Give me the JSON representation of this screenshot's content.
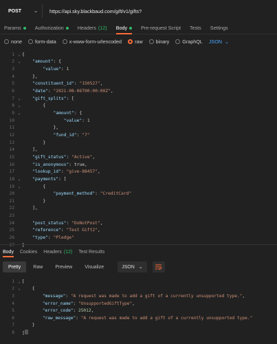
{
  "request": {
    "method": "POST",
    "url": "https://api.sky.blackbaud.com/gift/v1/gifts?"
  },
  "request_tabs": [
    {
      "label": "Params",
      "dot": true,
      "count": "",
      "active": false
    },
    {
      "label": "Authorization",
      "dot": true,
      "count": "",
      "active": false
    },
    {
      "label": "Headers",
      "dot": false,
      "count": "(12)",
      "active": false
    },
    {
      "label": "Body",
      "dot": true,
      "count": "",
      "active": true
    },
    {
      "label": "Pre-request Script",
      "dot": false,
      "count": "",
      "active": false
    },
    {
      "label": "Tests",
      "dot": false,
      "count": "",
      "active": false
    },
    {
      "label": "Settings",
      "dot": false,
      "count": "",
      "active": false
    }
  ],
  "body_types": [
    "none",
    "form-data",
    "x-www-form-urlencoded",
    "raw",
    "binary",
    "GraphQL"
  ],
  "body_type_selected": "raw",
  "body_format": "JSON",
  "request_body_lines": [
    "{",
    "    \"amount\": {",
    "        \"value\": 1",
    "    },",
    "    \"constituent_id\": \"150527\",",
    "    \"date\": \"2021-08-06T00:00:00Z\",",
    "    \"gift_splits\": [",
    "        {",
    "            \"amount\": {",
    "                \"value\": 1",
    "            },",
    "            \"fund_id\": \"7\"",
    "        }",
    "    ],",
    "    \"gift_status\": \"Active\",",
    "    \"is_anonymous\": true,",
    "    \"lookup_id\": \"give-88457\",",
    "    \"payments\": [",
    "        {",
    "            \"payment_method\": \"CreditCard\"",
    "        }",
    "    ],",
    "",
    "    \"post_status\": \"DoNotPost\",",
    "    \"reference\": \"Test Gift2\",",
    "    \"type\": \"Pledge\"",
    "}"
  ],
  "response_tabs": [
    {
      "label": "Body",
      "count": "",
      "active": true
    },
    {
      "label": "Cookies",
      "count": "",
      "active": false
    },
    {
      "label": "Headers",
      "count": "(12)",
      "active": false
    },
    {
      "label": "Test Results",
      "count": "",
      "active": false
    }
  ],
  "response_views": [
    "Pretty",
    "Raw",
    "Preview",
    "Visualize"
  ],
  "response_view_active": "Pretty",
  "response_format": "JSON",
  "response_body_lines": [
    "[",
    "    {",
    "        \"message\": \"A request was made to add a gift of a currently unsupported type.\",",
    "        \"error_name\": \"UnsupportedGiftType\",",
    "        \"error_code\": 25012,",
    "        \"raw_message\": \"A request was made to add a gift of a currently unsupported type.\"",
    "    }",
    "]"
  ],
  "colors": {
    "accent": "#ff6c37",
    "status_dot": "#2fbd6b",
    "json_key": "#9cdcfe",
    "json_string": "#ce9178",
    "json_number": "#b5cea8"
  }
}
